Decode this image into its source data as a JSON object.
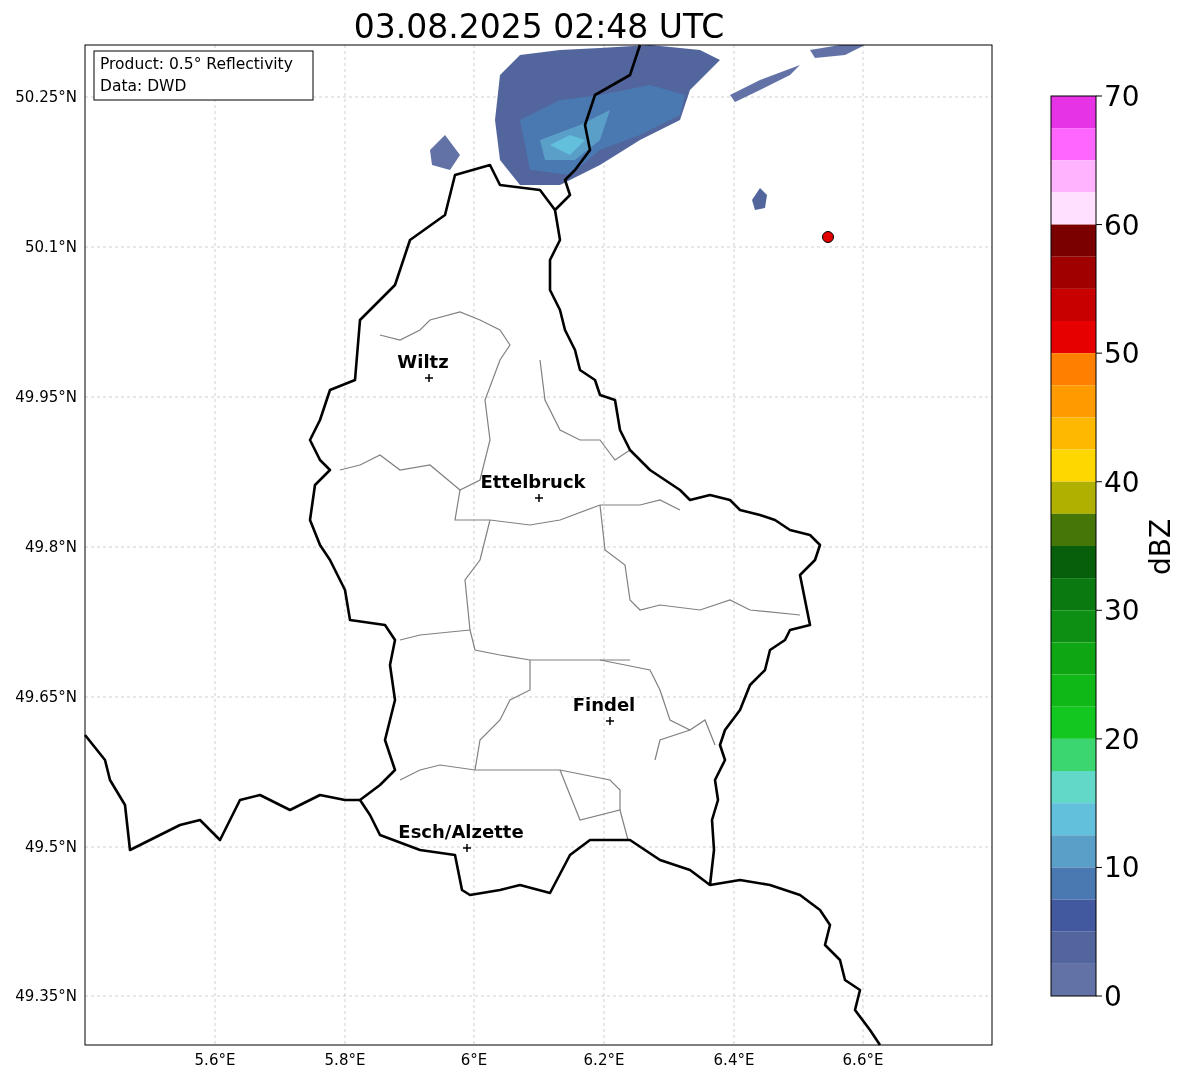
{
  "title": "03.08.2025 02:48 UTC",
  "info_box": [
    "Product: 0.5° Reflectivity",
    "Data: DWD"
  ],
  "lat_ticks": [
    "50.25°N",
    "50.1°N",
    "49.95°N",
    "49.8°N",
    "49.65°N",
    "49.5°N",
    "49.35°N"
  ],
  "lon_ticks": [
    "5.6°E",
    "5.8°E",
    "6°E",
    "6.2°E",
    "6.4°E",
    "6.6°E"
  ],
  "cities": [
    "Wiltz",
    "Ettelbruck",
    "Findel",
    "Esch/Alzette"
  ],
  "colorbar": {
    "label": "dBZ",
    "ticks": [
      "70",
      "60",
      "50",
      "40",
      "30",
      "20",
      "10",
      "0"
    ],
    "bins": [
      {
        "color": "#e633e6"
      },
      {
        "color": "#ff66ff"
      },
      {
        "color": "#ffb3ff"
      },
      {
        "color": "#ffe0ff"
      },
      {
        "color": "#7a0000"
      },
      {
        "color": "#a00000"
      },
      {
        "color": "#c80000"
      },
      {
        "color": "#e60000"
      },
      {
        "color": "#ff7f00"
      },
      {
        "color": "#ff9a00"
      },
      {
        "color": "#ffb800"
      },
      {
        "color": "#ffd700"
      },
      {
        "color": "#b0b000"
      },
      {
        "color": "#457607"
      },
      {
        "color": "#075e0b"
      },
      {
        "color": "#0a7a10"
      },
      {
        "color": "#0c8f12"
      },
      {
        "color": "#0ea612"
      },
      {
        "color": "#10b817"
      },
      {
        "color": "#11c720"
      },
      {
        "color": "#3cd670"
      },
      {
        "color": "#62d8c8"
      },
      {
        "color": "#62c0dc"
      },
      {
        "color": "#5a9fc8"
      },
      {
        "color": "#4a78b0"
      },
      {
        "color": "#42589f"
      },
      {
        "color": "#52659d"
      },
      {
        "color": "#6272a6"
      }
    ]
  }
}
